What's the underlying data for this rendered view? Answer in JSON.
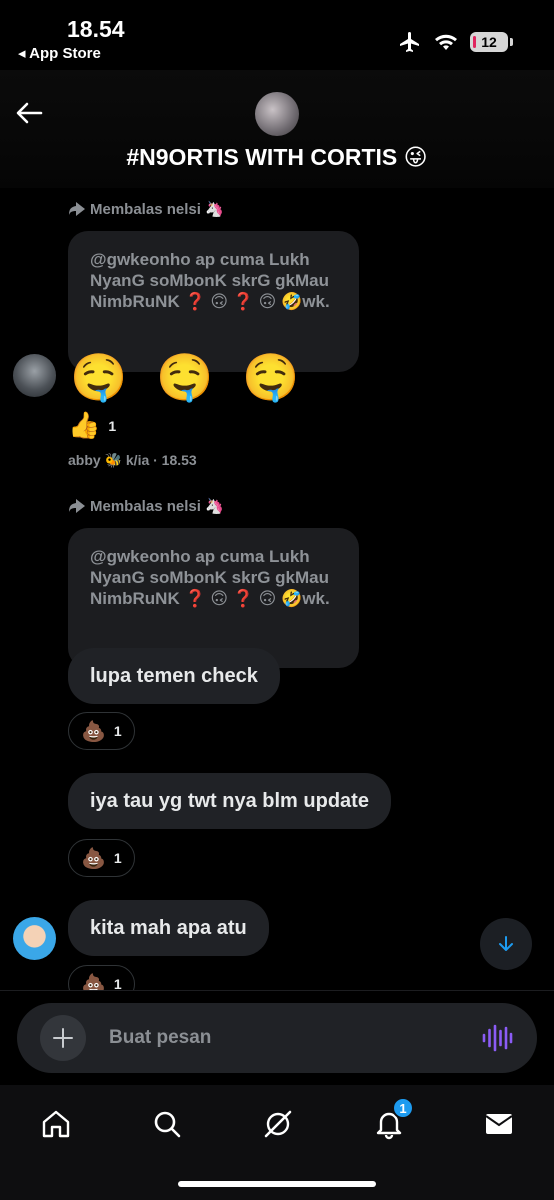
{
  "status_bar": {
    "time": "18.54",
    "back_label": "◂ App Store",
    "battery": "12"
  },
  "header": {
    "title": "#N9ORTIS WITH CORTIS 😜"
  },
  "messages": [
    {
      "reply_label": "Membalas nelsi 🦄",
      "quoted_text": "@gwkeonho ap cuma Lukh NyanG soMbonK skrG gkMau NimbRuNK ❓ 🙃 ❓ 🙃 🤣wk.",
      "body": "🤤 🤤 🤤",
      "reaction_emoji": "👍",
      "reaction_count": "1",
      "meta": "abby 🐝 k/ia · 18.53"
    },
    {
      "reply_label": "Membalas nelsi 🦄",
      "quoted_text": "@gwkeonho ap cuma Lukh NyanG soMbonK skrG gkMau NimbRuNK ❓ 🙃 ❓ 🙃 🤣wk.",
      "body": "lupa temen check",
      "reaction_emoji": "💩",
      "reaction_count": "1"
    },
    {
      "body": "iya tau yg twt nya blm update",
      "reaction_emoji": "💩",
      "reaction_count": "1"
    },
    {
      "body": "kita mah apa atu",
      "reaction_emoji": "💩",
      "reaction_count": "1"
    }
  ],
  "composer": {
    "placeholder": "Buat pesan"
  },
  "nav": {
    "notification_count": "1"
  },
  "colors": {
    "accent": "#1d9bf0",
    "voice_accent": "#8b5cf6",
    "bubble": "#202226"
  }
}
